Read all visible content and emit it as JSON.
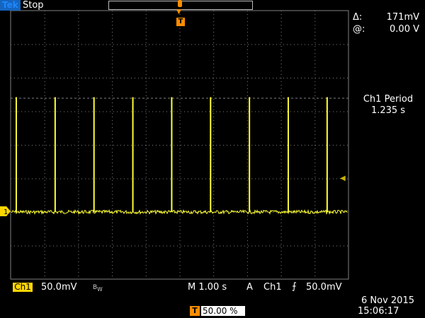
{
  "header": {
    "brand": "Tek",
    "status": "Stop"
  },
  "cursor_readout": {
    "delta_label": "Δ:",
    "delta_value": "171mV",
    "at_label": "@:",
    "at_value": "0.00 V"
  },
  "measurement": {
    "title": "Ch1 Period",
    "value": "1.235 s"
  },
  "channel": {
    "badge": "Ch1",
    "scale": "50.0mV",
    "bw_icon": "bandwidth-limit-icon",
    "ground_marker": "1"
  },
  "timebase": "M 1.00 s",
  "trigger": {
    "mode": "A",
    "source": "Ch1",
    "slope_icon": "rising-edge-icon",
    "level": "50.0mV",
    "marker": "T"
  },
  "horizontal_position": "50.00 %",
  "datetime": {
    "date": "6 Nov 2015",
    "time": "15:06:17"
  },
  "colors": {
    "trace": "#ffff33",
    "trigger": "#ff8c00",
    "grid": "#808080",
    "background": "#000000"
  },
  "waveform": {
    "pulse_times_s": [
      0.0,
      1.15,
      2.3,
      3.45,
      4.6,
      5.75,
      6.9,
      8.05,
      9.2
    ],
    "baseline_mV": 0,
    "pulse_amplitude_mV": 171,
    "x_range_s": [
      0,
      10
    ],
    "y_range_mV": [
      -100,
      300
    ]
  }
}
